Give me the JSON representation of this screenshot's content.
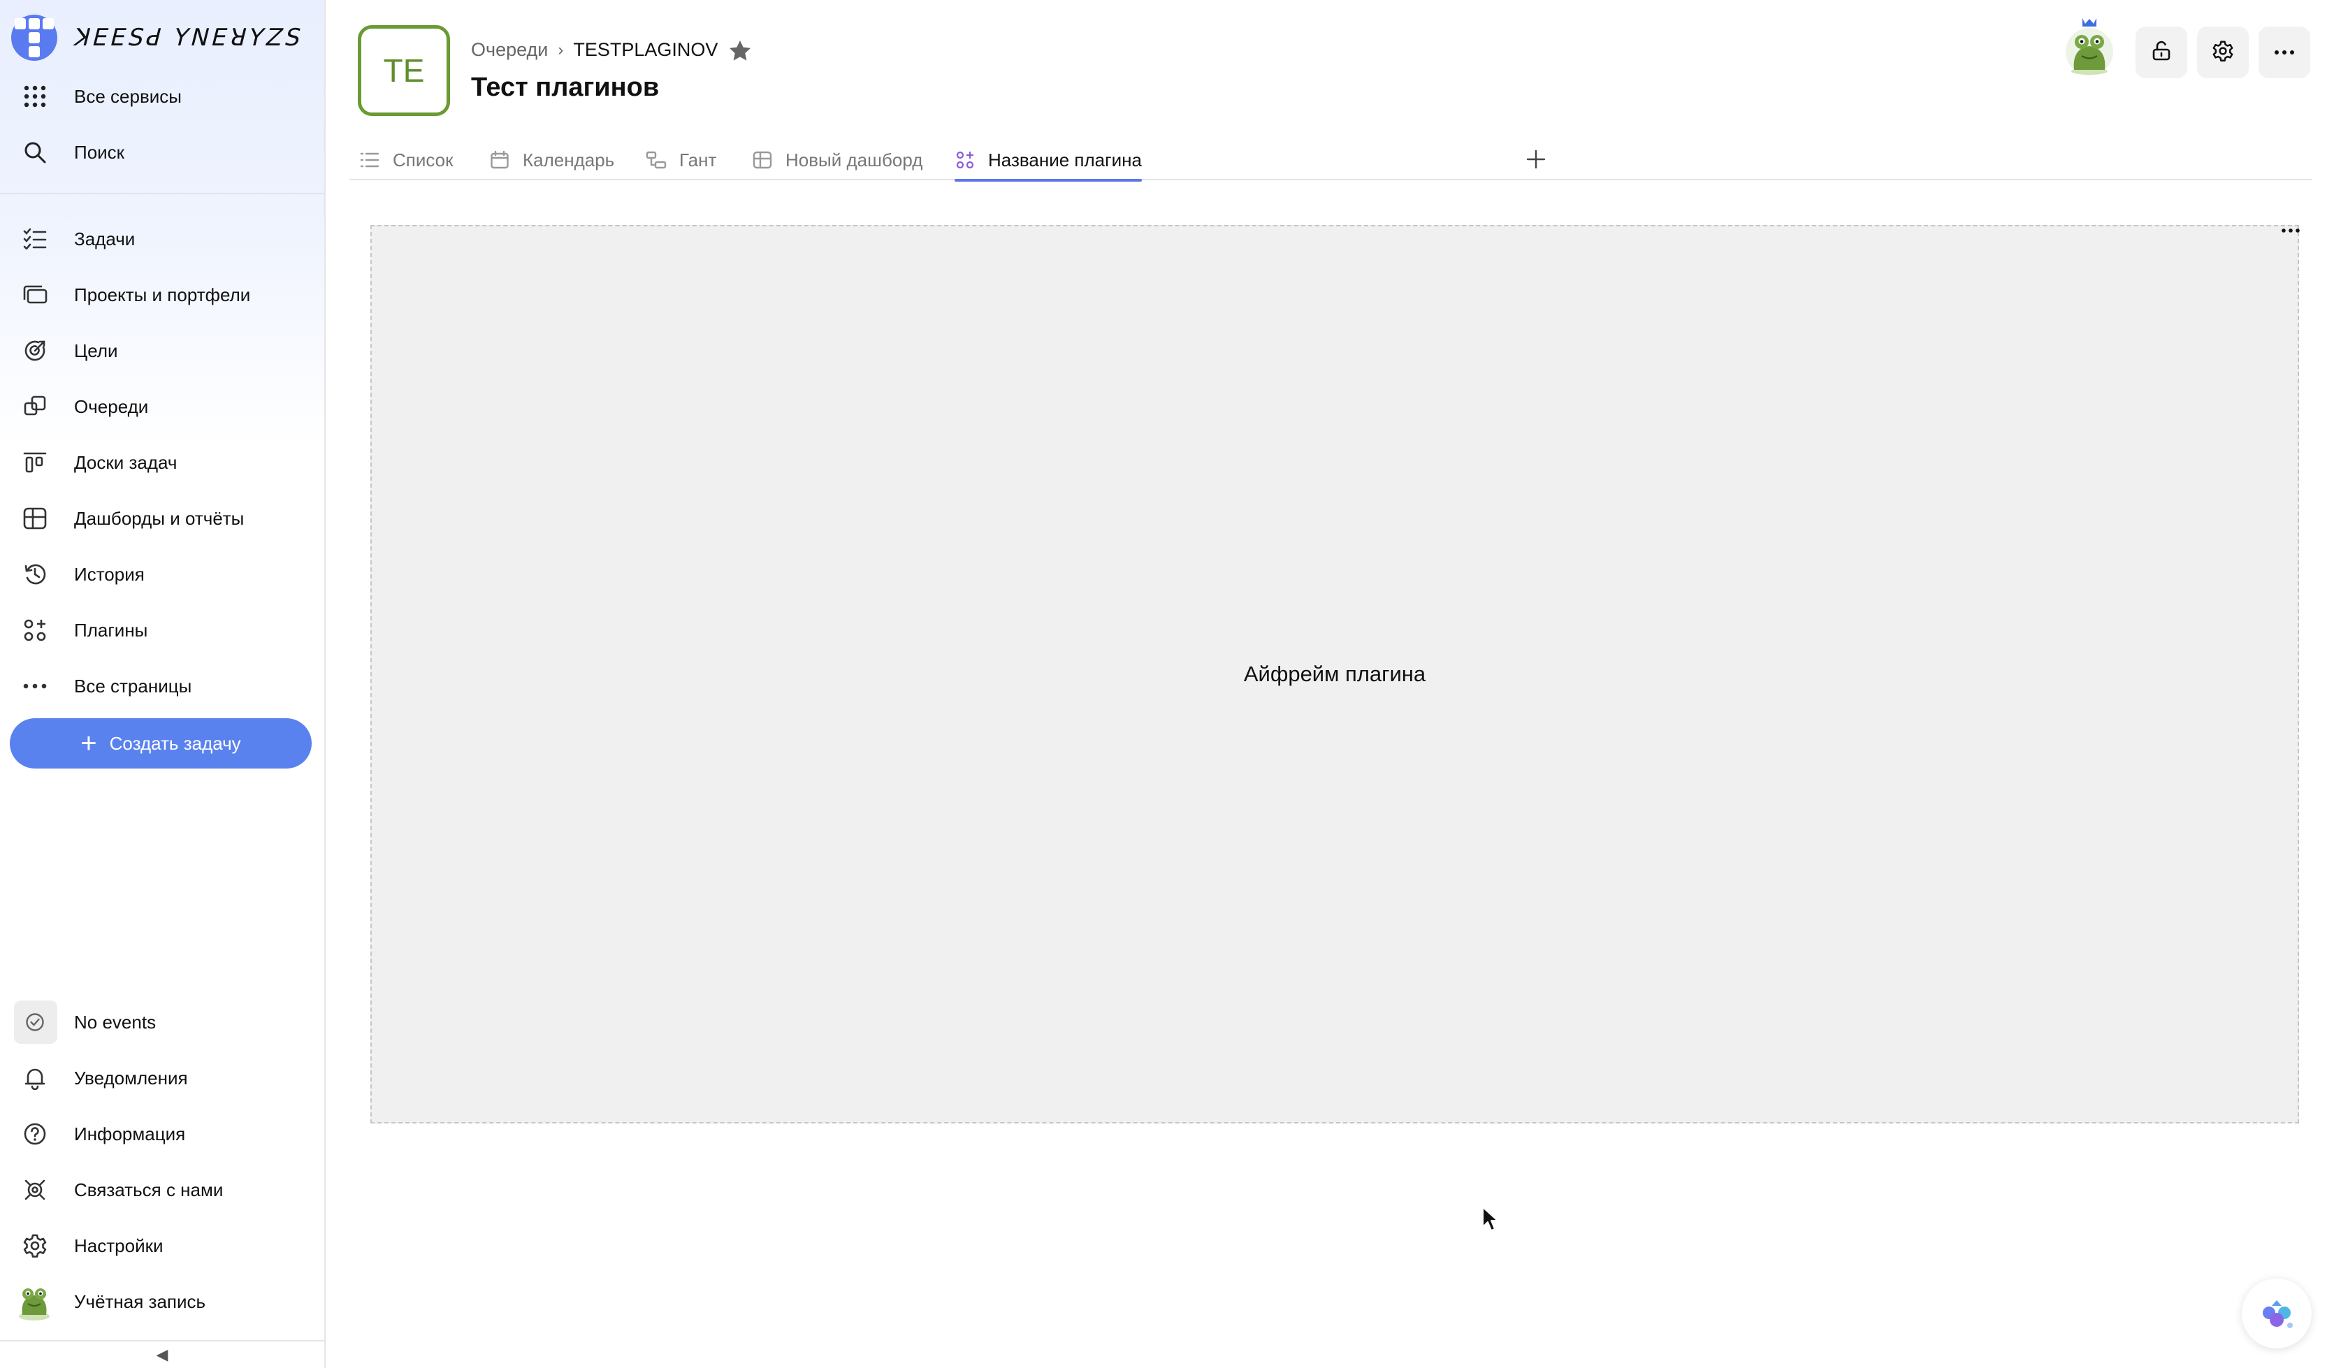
{
  "app": {
    "logo_text": "ꓘꓰꓰꓢꓒ ꓬꓠꓰꓤꓬꓜꓢ"
  },
  "sidebar": {
    "top_items": [
      {
        "label": "Все сервисы",
        "icon": "grid-dots-icon"
      },
      {
        "label": "Поиск",
        "icon": "search-icon"
      }
    ],
    "items": [
      {
        "label": "Задачи",
        "icon": "task-list-icon"
      },
      {
        "label": "Проекты и портфели",
        "icon": "portfolio-icon"
      },
      {
        "label": "Цели",
        "icon": "target-icon"
      },
      {
        "label": "Очереди",
        "icon": "queues-icon"
      },
      {
        "label": "Доски задач",
        "icon": "board-icon"
      },
      {
        "label": "Дашборды и отчёты",
        "icon": "dashboard-icon"
      },
      {
        "label": "История",
        "icon": "history-icon"
      },
      {
        "label": "Плагины",
        "icon": "plugins-icon"
      },
      {
        "label": "Все страницы",
        "icon": "more-dots-icon"
      }
    ],
    "create_button": "Создать задачу",
    "bottom_items": [
      {
        "label": "No events",
        "icon": "check-circle-icon"
      },
      {
        "label": "Уведомления",
        "icon": "bell-icon"
      },
      {
        "label": "Информация",
        "icon": "help-circle-icon"
      },
      {
        "label": "Связаться с нами",
        "icon": "support-icon"
      },
      {
        "label": "Настройки",
        "icon": "gear-icon"
      },
      {
        "label": "Учётная запись",
        "icon": "user-avatar-icon"
      }
    ],
    "collapse_glyph": "◀"
  },
  "header": {
    "queue_avatar_text": "TE",
    "breadcrumb": {
      "parent": "Очереди",
      "separator": "›",
      "key": "TESTPLAGINOV"
    },
    "title": "Тест плагинов",
    "actions": [
      "lock-icon",
      "gear-icon",
      "more-dots-icon"
    ]
  },
  "tabs": [
    {
      "label": "Список",
      "icon": "list-icon",
      "active": false
    },
    {
      "label": "Календарь",
      "icon": "calendar-icon",
      "active": false
    },
    {
      "label": "Гант",
      "icon": "gantt-icon",
      "active": false
    },
    {
      "label": "Новый дашборд",
      "icon": "dashboard-icon",
      "active": false
    },
    {
      "label": "Название плагина",
      "icon": "plugins-icon",
      "active": true
    }
  ],
  "plugin": {
    "frame_text": "Айфрейм плагина"
  },
  "colors": {
    "accent": "#5a82ee",
    "queue_avatar": "#6a9a34",
    "frame_bg": "#f0f0f0"
  }
}
